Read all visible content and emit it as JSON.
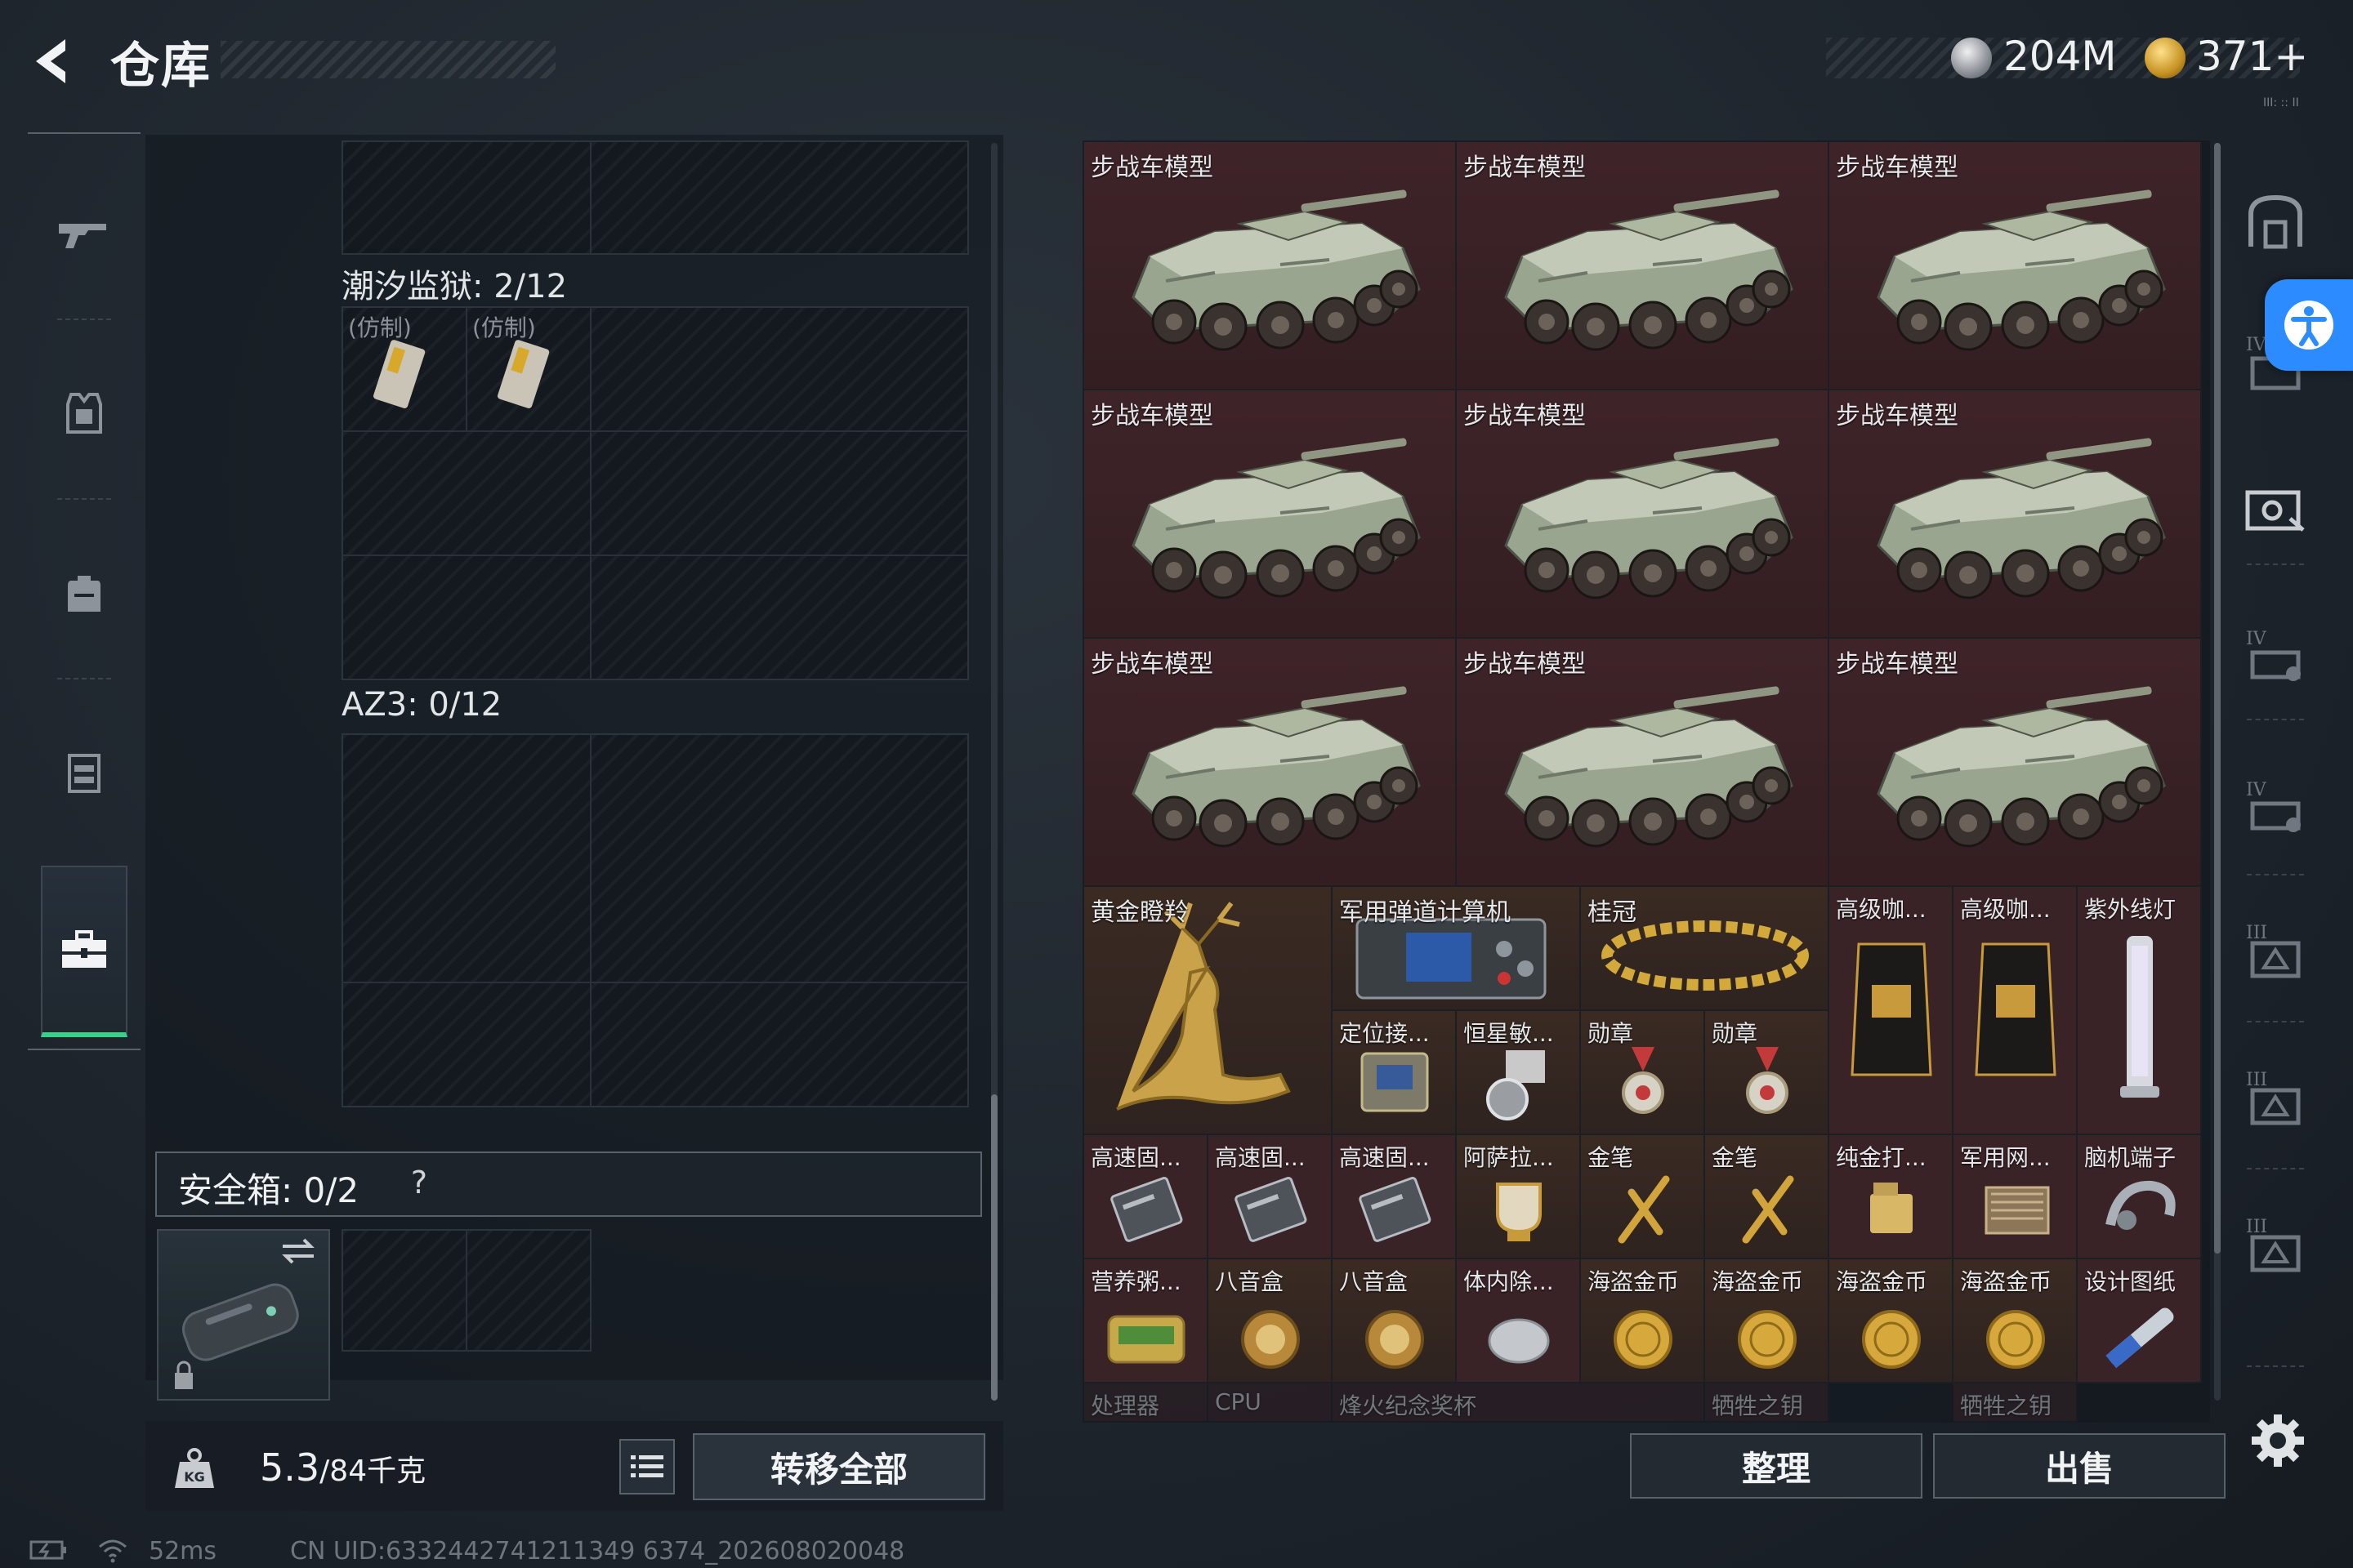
{
  "header": {
    "title": "仓库",
    "currency_1_value": "204M",
    "currency_2_value": "371+",
    "corner_tag": "III: :: II"
  },
  "left_nav": {
    "items": [
      {
        "name": "weapons",
        "icon": "rifle-icon"
      },
      {
        "name": "armor",
        "icon": "vest-icon"
      },
      {
        "name": "backpack",
        "icon": "backpack-icon"
      },
      {
        "name": "chest-rig",
        "icon": "chest-rig-icon"
      },
      {
        "name": "stash",
        "icon": "toolbox-icon",
        "active": true
      }
    ]
  },
  "stash": {
    "container_1": {
      "label": "潮汐监狱: 2/12",
      "items": [
        "(仿制)",
        "(仿制)"
      ]
    },
    "container_2": {
      "label": "AZ3: 0/12"
    },
    "safebox": {
      "label": "安全箱: 0/2",
      "help": "?"
    }
  },
  "bottom_left": {
    "weight_current": "5.3",
    "weight_max": "/84千克",
    "transfer_all": "转移全部"
  },
  "items": {
    "vehicle_models": [
      "步战车模型",
      "步战车模型",
      "步战车模型",
      "步战车模型",
      "步战车模型",
      "步战车模型",
      "步战车模型",
      "步战车模型",
      "步战车模型"
    ],
    "row4": {
      "golden_deer": "黄金瞪羚",
      "ballistic_computer": "军用弹道计算机",
      "laurel": "桂冠",
      "coffee_1": "高级咖...",
      "coffee_2": "高级咖...",
      "uv_lamp": "紫外线灯",
      "locator": "定位接...",
      "star_sensor": "恒星敏...",
      "medal_1": "勋章",
      "medal_2": "勋章"
    },
    "row5": [
      "高速固...",
      "高速固...",
      "高速固...",
      "阿萨拉...",
      "金笔",
      "金笔",
      "纯金打...",
      "军用网...",
      "脑机端子"
    ],
    "row6": [
      "营养粥...",
      "八音盒",
      "八音盒",
      "体内除...",
      "海盗金币",
      "海盗金币",
      "海盗金币",
      "海盗金币",
      "设计图纸"
    ],
    "row7": [
      "处理器",
      "CPU",
      "烽火纪念奖杯",
      "牺牲之钥",
      "牺牲之钥"
    ]
  },
  "actions": {
    "sort": "整理",
    "sell": "出售"
  },
  "status_bar": {
    "ping": "52ms",
    "uid": "CN UID:6332442741211349 6374_202608020048"
  },
  "right_nav": {
    "tags": [
      "IV",
      "IV",
      "IV",
      "III",
      "III",
      "III"
    ]
  },
  "colors": {
    "accent_green": "#39d08a",
    "accessibility_blue": "#2b8bff",
    "rare_item_bg": "#3a2327"
  }
}
